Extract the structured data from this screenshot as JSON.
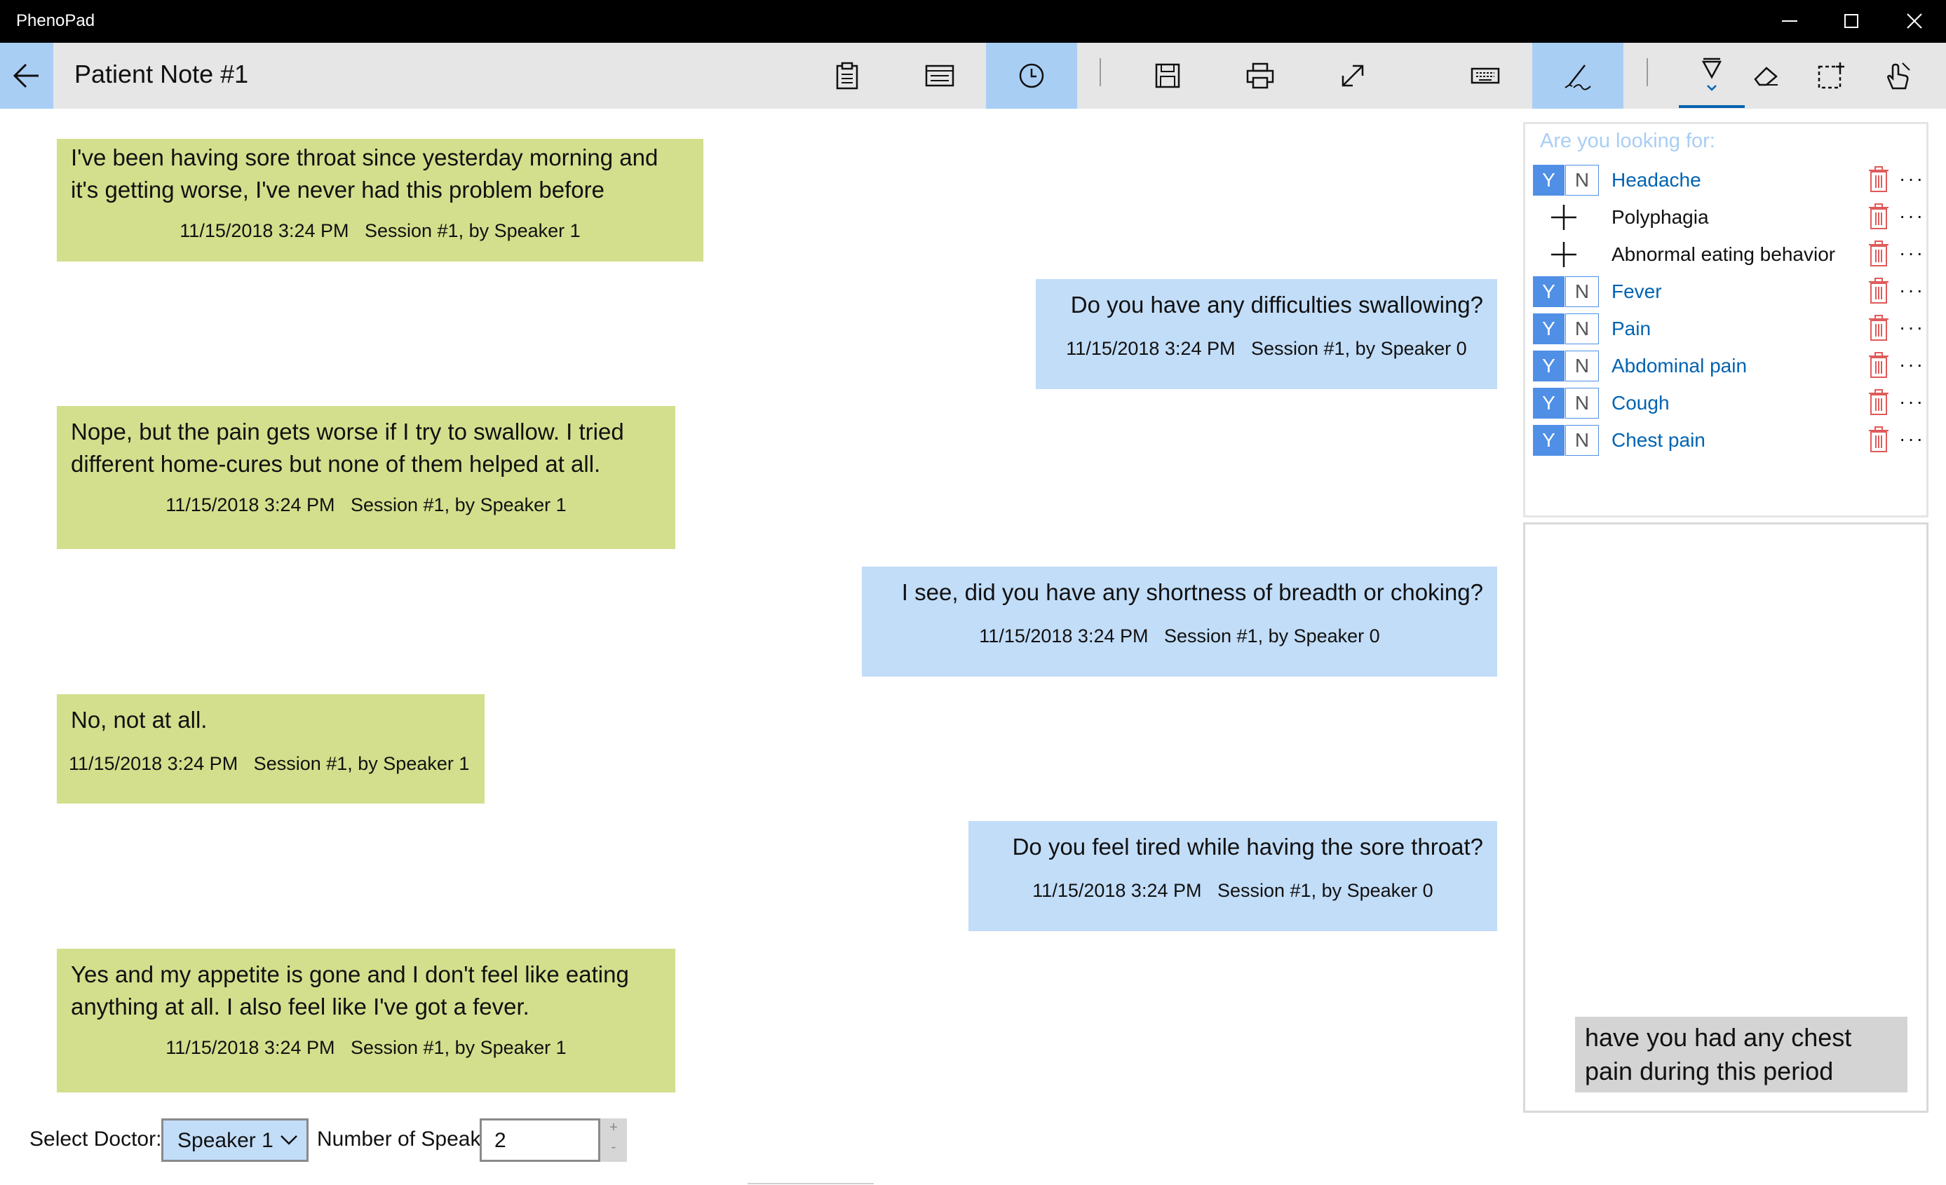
{
  "app": {
    "title": "PhenoPad"
  },
  "window_controls": {
    "minimize_icon": "minimize-icon",
    "maximize_icon": "maximize-icon",
    "close_icon": "close-icon"
  },
  "header": {
    "note_title": "Patient Note #1"
  },
  "toolbar": {
    "buttons": [
      {
        "icon": "clipboard-icon",
        "active": false
      },
      {
        "icon": "keyboard-notes-icon",
        "active": false
      },
      {
        "icon": "clock-icon",
        "active": true
      },
      {
        "icon": "save-icon",
        "active": false
      },
      {
        "icon": "print-icon",
        "active": false
      },
      {
        "icon": "expand-icon",
        "active": false
      },
      {
        "icon": "keyboard-icon",
        "active": false
      },
      {
        "icon": "handwriting-icon",
        "active": true
      },
      {
        "icon": "pen-icon",
        "active": false
      },
      {
        "icon": "eraser-icon",
        "active": false
      },
      {
        "icon": "lasso-select-icon",
        "active": false
      },
      {
        "icon": "touch-writing-icon",
        "active": false
      }
    ]
  },
  "conversation": [
    {
      "speaker": "patient",
      "text": "I've been having sore throat since yesterday morning and it's getting worse, I've never had this problem before",
      "meta": "11/15/2018 3:24 PM   Session #1, by Speaker 1"
    },
    {
      "speaker": "doctor",
      "text": "Do you have any difficulties swallowing?",
      "meta": "11/15/2018 3:24 PM   Session #1, by Speaker 0"
    },
    {
      "speaker": "patient",
      "text": "Nope, but the pain gets worse if I try to swallow. I tried different home-cures but none of them helped at all.",
      "meta": "11/15/2018 3:24 PM   Session #1, by Speaker 1"
    },
    {
      "speaker": "doctor",
      "text": "I see, did you have any shortness of breadth or choking?",
      "meta": "11/15/2018 3:24 PM   Session #1, by Speaker 0"
    },
    {
      "speaker": "patient",
      "text": "No, not at all.",
      "meta": "11/15/2018 3:24 PM   Session #1, by Speaker 1"
    },
    {
      "speaker": "doctor",
      "text": "Do you feel tired while having the sore throat?",
      "meta": "11/15/2018 3:24 PM   Session #1, by Speaker 0"
    },
    {
      "speaker": "patient",
      "text": "Yes and my appetite is gone and I don't feel like eating anything at all. I also feel like I've got a fever.",
      "meta": "11/15/2018 3:24 PM   Session #1, by Speaker 1"
    }
  ],
  "phenotype_panel": {
    "heading": "Are you looking for:",
    "y_label": "Y",
    "n_label": "N",
    "more_label": "···",
    "items": [
      {
        "label": "Headache",
        "state": "yn"
      },
      {
        "label": "Polyphagia",
        "state": "add"
      },
      {
        "label": "Abnormal eating behavior",
        "state": "add"
      },
      {
        "label": "Fever",
        "state": "yn"
      },
      {
        "label": "Pain",
        "state": "yn"
      },
      {
        "label": "Abdominal pain",
        "state": "yn"
      },
      {
        "label": "Cough",
        "state": "yn"
      },
      {
        "label": "Chest pain",
        "state": "yn"
      }
    ]
  },
  "note_panel": {
    "suggestion": "have you had any chest pain during this period"
  },
  "controls": {
    "select_doctor_label": "Select Doctor:",
    "select_doctor_value": "Speaker 1",
    "num_speakers_label": "Number of Speakers:",
    "num_speakers_value": "2",
    "stepper_up": "+",
    "stepper_down": "-"
  },
  "colors": {
    "patient_bubble": "#d3df8c",
    "doctor_bubble": "#c2ddf8",
    "accent_blue": "#4f8fe6",
    "link_blue": "#0063b1",
    "trash_red": "#e05a5a"
  }
}
